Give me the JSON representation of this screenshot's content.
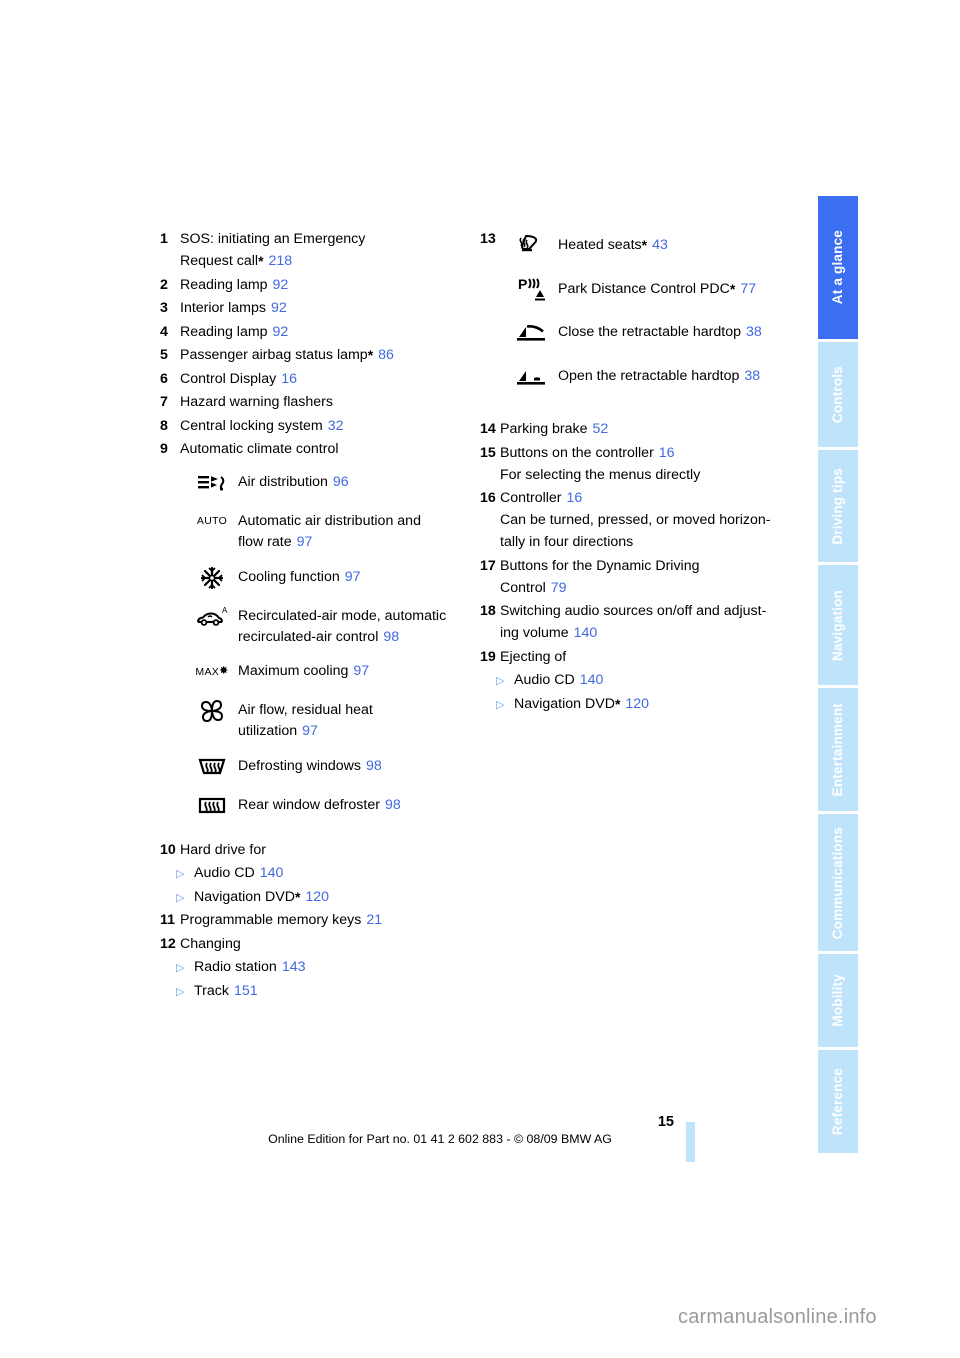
{
  "document": {
    "page_number": "15",
    "edition_line": "Online Edition for Part no. 01 41 2 602 883 - © 08/09 BMW AG",
    "watermark": "carmanualsonline.info",
    "accent_blue": "#4169e1",
    "tab_active_color": "#3b6ef0",
    "tab_inactive_color": "#bfe3fa"
  },
  "tabs": [
    {
      "label": "At a glance",
      "active": true
    },
    {
      "label": "Controls",
      "active": false
    },
    {
      "label": "Driving tips",
      "active": false
    },
    {
      "label": "Navigation",
      "active": false
    },
    {
      "label": "Entertainment",
      "active": false
    },
    {
      "label": "Communications",
      "active": false
    },
    {
      "label": "Mobility",
      "active": false
    },
    {
      "label": "Reference",
      "active": false
    }
  ],
  "left_column": {
    "entries": [
      {
        "num": "1",
        "text": "SOS: initiating an Emergency",
        "line2": "Request call",
        "star": true,
        "ref": "218"
      },
      {
        "num": "2",
        "text": "Reading lamp",
        "ref": "92"
      },
      {
        "num": "3",
        "text": "Interior lamps",
        "ref": "92"
      },
      {
        "num": "4",
        "text": "Reading lamp",
        "ref": "92"
      },
      {
        "num": "5",
        "text": "Passenger airbag status lamp",
        "star": true,
        "ref": "86"
      },
      {
        "num": "6",
        "text": "Control Display",
        "ref": "16"
      },
      {
        "num": "7",
        "text": "Hazard warning flashers",
        "ref": ""
      },
      {
        "num": "8",
        "text": "Central locking system",
        "ref": "32"
      },
      {
        "num": "9",
        "text": "Automatic climate control",
        "ref": ""
      }
    ],
    "climate_icons": [
      {
        "icon": "air-distribution-icon",
        "text": "Air distribution",
        "ref": "96"
      },
      {
        "icon": "auto-icon",
        "text": "Automatic air distribution and",
        "line2": "flow rate",
        "ref": "97"
      },
      {
        "icon": "cooling-snowflake-icon",
        "text": "Cooling function",
        "ref": "97"
      },
      {
        "icon": "recirculated-air-icon",
        "text": "Recirculated-air mode, automatic",
        "line2": "recirculated-air control",
        "ref": "98"
      },
      {
        "icon": "max-cooling-icon",
        "text": "Maximum cooling",
        "ref": "97"
      },
      {
        "icon": "fan-icon",
        "text": "Air flow, residual heat",
        "line2": "utilization",
        "ref": "97"
      },
      {
        "icon": "defrost-windshield-icon",
        "text": "Defrosting windows",
        "ref": "98"
      },
      {
        "icon": "rear-defroster-icon",
        "text": "Rear window defroster",
        "ref": "98"
      }
    ],
    "entries_after": [
      {
        "num": "10",
        "text": "Hard drive for",
        "ref": "",
        "bullets": [
          {
            "text": "Audio CD",
            "ref": "140"
          },
          {
            "text": "Navigation DVD",
            "star": true,
            "ref": "120"
          }
        ]
      },
      {
        "num": "11",
        "text": "Programmable memory keys",
        "ref": "21"
      },
      {
        "num": "12",
        "text": "Changing",
        "ref": "",
        "bullets": [
          {
            "text": "Radio station",
            "ref": "143"
          },
          {
            "text": "Track",
            "ref": "151"
          }
        ]
      }
    ],
    "glyph_labels": {
      "auto": "AUTO",
      "max": "MAX",
      "recirc_superscript": "A"
    }
  },
  "right_column": {
    "group13": {
      "num": "13",
      "icons": [
        {
          "icon": "heated-seats-icon",
          "text": "Heated seats",
          "star": true,
          "ref": "43"
        },
        {
          "icon": "pdc-icon",
          "text": "Park Distance Control PDC",
          "star": true,
          "ref": "77"
        },
        {
          "icon": "close-hardtop-icon",
          "text": "Close the retractable hardtop",
          "ref": "38"
        },
        {
          "icon": "open-hardtop-icon",
          "text": "Open the retractable hardtop",
          "ref": "38"
        }
      ]
    },
    "entries": [
      {
        "num": "14",
        "text": "Parking brake",
        "ref": "52"
      },
      {
        "num": "15",
        "text": "Buttons on the controller",
        "ref": "16",
        "line2": "For selecting the menus directly"
      },
      {
        "num": "16",
        "text": "Controller",
        "ref": "16",
        "line2": "Can be turned, pressed, or moved horizon-",
        "line3": "tally in four directions"
      },
      {
        "num": "17",
        "text": "Buttons for the Dynamic Driving",
        "line2": "Control",
        "ref": "79"
      },
      {
        "num": "18",
        "text": "Switching audio sources on/off and adjust-",
        "line2": "ing volume",
        "ref": "140"
      },
      {
        "num": "19",
        "text": "Ejecting of",
        "ref": "",
        "bullets": [
          {
            "text": "Audio CD",
            "ref": "140"
          },
          {
            "text": "Navigation DVD",
            "star": true,
            "ref": "120"
          }
        ]
      }
    ]
  }
}
